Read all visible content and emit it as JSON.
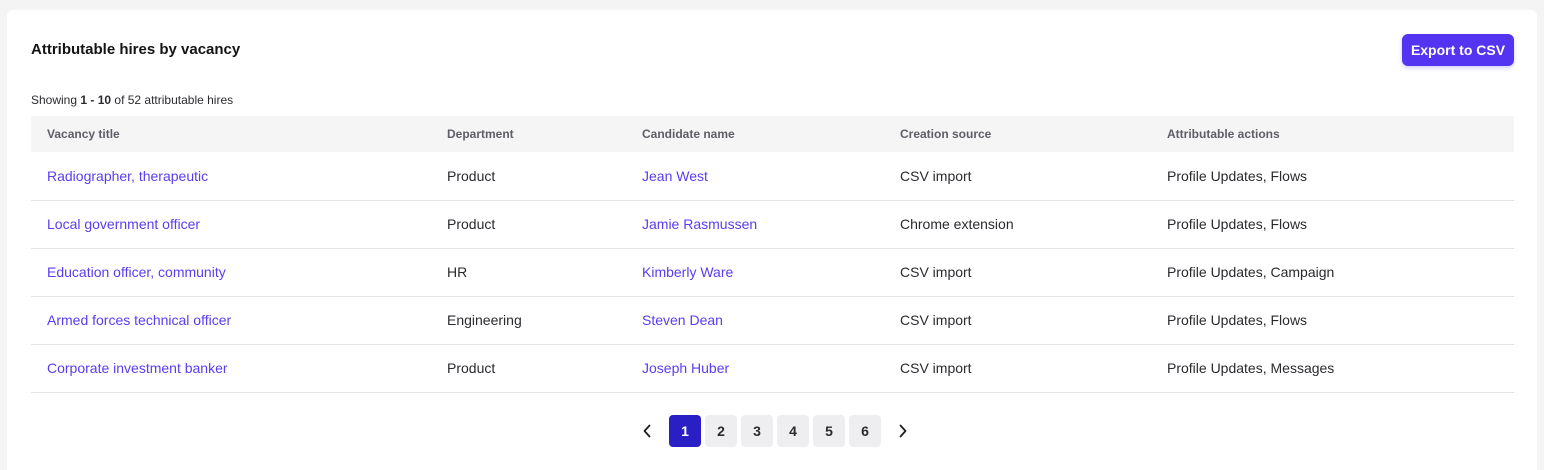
{
  "card": {
    "title": "Attributable hires by vacancy",
    "export_label": "Export to CSV"
  },
  "summary": {
    "prefix": "Showing ",
    "range": "1 - 10",
    "suffix": " of 52 attributable hires"
  },
  "table": {
    "columns": [
      "Vacancy title",
      "Department",
      "Candidate name",
      "Creation source",
      "Attributable actions"
    ],
    "rows": [
      {
        "vacancy": "Radiographer, therapeutic",
        "department": "Product",
        "candidate": "Jean West",
        "source": "CSV import",
        "actions": "Profile Updates, Flows"
      },
      {
        "vacancy": "Local government officer",
        "department": "Product",
        "candidate": "Jamie Rasmussen",
        "source": "Chrome extension",
        "actions": "Profile Updates, Flows"
      },
      {
        "vacancy": "Education officer, community",
        "department": "HR",
        "candidate": "Kimberly Ware",
        "source": "CSV import",
        "actions": "Profile Updates, Campaign"
      },
      {
        "vacancy": "Armed forces technical officer",
        "department": "Engineering",
        "candidate": "Steven Dean",
        "source": "CSV import",
        "actions": "Profile Updates, Flows"
      },
      {
        "vacancy": "Corporate investment banker",
        "department": "Product",
        "candidate": "Joseph Huber",
        "source": "CSV import",
        "actions": "Profile Updates, Messages"
      }
    ]
  },
  "pagination": {
    "pages": [
      "1",
      "2",
      "3",
      "4",
      "5",
      "6"
    ],
    "current": "1",
    "prev_icon": "chevron-left-icon",
    "next_icon": "chevron-right-icon"
  },
  "colors": {
    "accent": "#5434f0",
    "link": "#5a3df0",
    "active_page": "#2a1fc4"
  }
}
